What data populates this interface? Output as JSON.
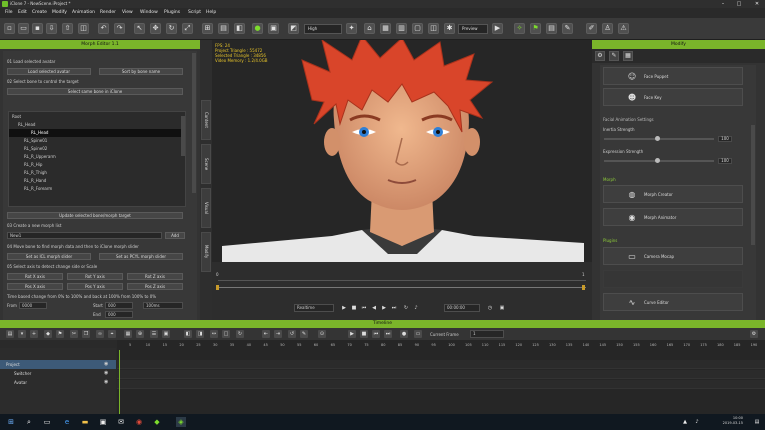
{
  "window": {
    "title": "iClone 7 - NewScene.iProject *",
    "min": "–",
    "max": "□",
    "close": "✕"
  },
  "menu": [
    "File",
    "Edit",
    "Create",
    "Modify",
    "Animation",
    "Render",
    "View",
    "Window",
    "Plugins",
    "Script",
    "Help"
  ],
  "toolbar": {
    "quality": "High",
    "preview": "Preview"
  },
  "left_panel": {
    "title": "Morph Editor 1.1",
    "load_label": "01 Load selected avatar",
    "load_button": "Load selected avatar",
    "sort_button": "Sort by bone name",
    "select_label": "02 Select bone to control the target",
    "select_button": "Select same bone in iClone",
    "tree": [
      "Root",
      "RL_Head",
      "RL_Head",
      "RL_Spine01",
      "RL_Spine02",
      "RL_R_Upperarm",
      "RL_R_Hip",
      "RL_R_Thigh",
      "RL_R_Hand",
      "RL_R_Forearm"
    ],
    "update_button": "Update selected bone/morph target",
    "create_label": "03 Create a new morph list",
    "name_placeholder": "New1",
    "add_button": "Add",
    "move_label": "04 Move bone to find morph data and then to iClone morph slider",
    "set_button1": "Set as ICL morph slider",
    "set_button2": "Set as PCYL morph slider",
    "select_axis_label": "05 Select axis to detect change side or Scale",
    "axes": [
      "Rot X axis",
      "Rot Y axis",
      "Rot Z axis",
      "Pos X axis",
      "Pos Y axis",
      "Pos Z axis"
    ],
    "range_label": "Time based change from 0% to 100% and back at 100% from 100% to 0%",
    "from_label": "From",
    "from_val": "0000",
    "to_label": "Start",
    "to_val": "000",
    "speed_val": "100ms",
    "end_label": "End",
    "end_val": "000"
  },
  "side_tabs": [
    "Content",
    "Scene",
    "Visual",
    "Modify"
  ],
  "viewport": {
    "stats": "FPS: 24\nProject Triangle : 55472\nSelected Triangle : 34856\nVideo Memory : 1.2/4.0GB"
  },
  "timebar": {
    "realtime": "Realtime",
    "frame": "00:00:00",
    "markers": [
      "0",
      "1"
    ]
  },
  "right_panel": {
    "title": "Modify",
    "cards_top": [
      {
        "icon": "face-puppet-icon",
        "label": "Face Puppet"
      },
      {
        "icon": "face-key-icon",
        "label": "Face Key"
      }
    ],
    "section_facial": "Facial Animation Settings",
    "sliders": [
      {
        "label": "Inertia Strength",
        "value": "100"
      },
      {
        "label": "Expression Strength",
        "value": "100"
      }
    ],
    "section_morph": "Morph",
    "cards_morph": [
      {
        "icon": "morph-creator-icon",
        "label": "Morph Creator"
      },
      {
        "icon": "morph-animator-icon",
        "label": "Morph Animator"
      }
    ],
    "section_plugins": "Plugins",
    "cards_plugins": [
      {
        "icon": "camera-mocap-icon",
        "label": "Camera Mocap"
      },
      {
        "icon": "curve-editor-icon",
        "label": "Curve Editor"
      }
    ]
  },
  "timeline": {
    "title": "Timeline",
    "current_frame_label": "Current Frame",
    "current_frame": "1",
    "tracks": [
      "Project",
      "Switcher",
      "Avatar"
    ],
    "ruler": [
      "5",
      "10",
      "15",
      "20",
      "25",
      "30",
      "35",
      "40",
      "45",
      "50",
      "55",
      "60",
      "65",
      "70",
      "75",
      "80",
      "85",
      "90",
      "95",
      "100",
      "105",
      "110",
      "115",
      "120",
      "125",
      "130",
      "135",
      "140",
      "145",
      "150",
      "155",
      "160",
      "165",
      "170",
      "175",
      "180",
      "185",
      "190"
    ]
  },
  "taskbar": {
    "clock": "10:00",
    "date": "2019-03-15"
  },
  "colors": {
    "accent": "#7ab52a",
    "hair": "#d9452a",
    "skin": "#e6a77d",
    "stats": "#e8c52a"
  }
}
